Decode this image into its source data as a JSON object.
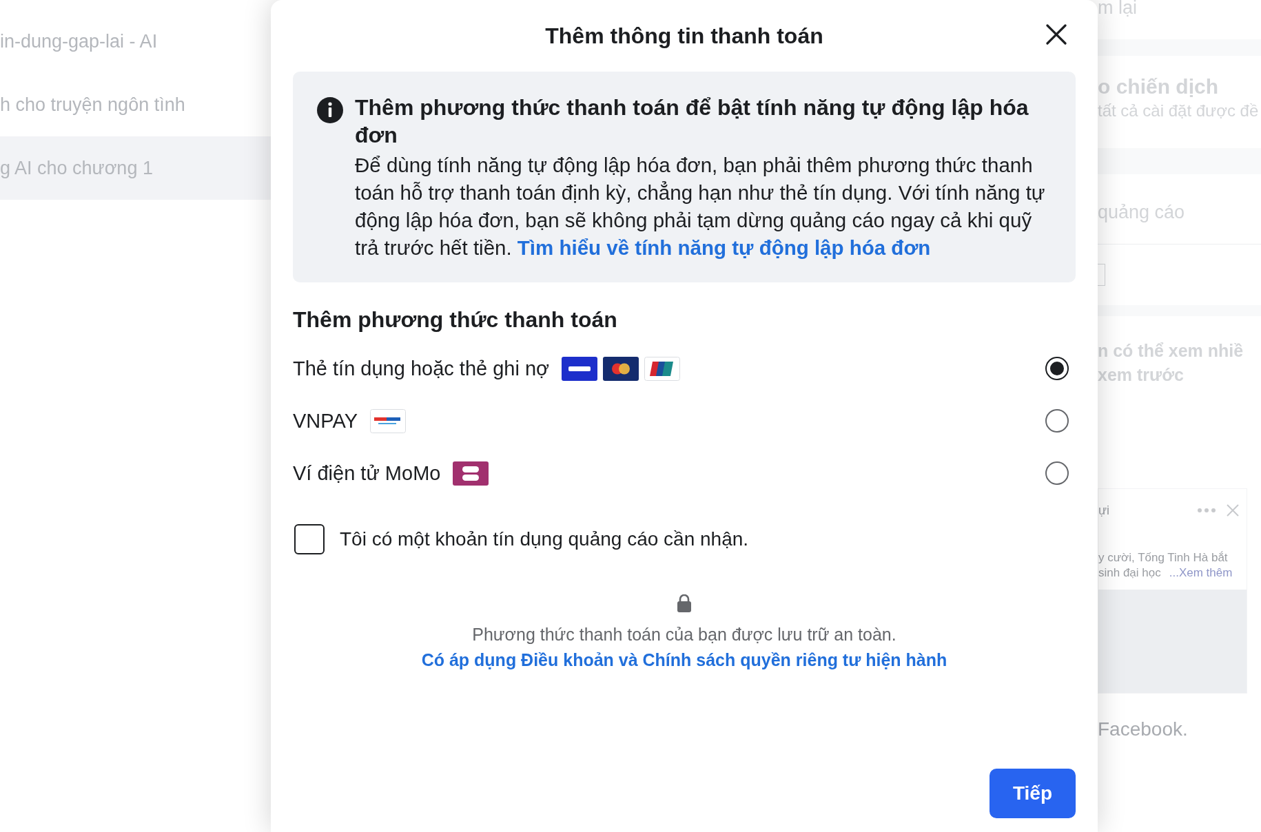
{
  "background_left": {
    "items": [
      {
        "label": "in-dung-gap-lai - AI",
        "selected": false
      },
      {
        "label": "h cho truyện ngôn tình",
        "selected": false
      },
      {
        "label": "g AI cho chương 1",
        "selected": true
      }
    ]
  },
  "background_right": {
    "top_text": "m lại",
    "section_title": "o chiến dịch",
    "section_subtitle": "tất cả cài đặt được đề",
    "field_label": "quảng cáo",
    "preview_title": "n có thể xem nhiề",
    "preview_title_2": "xem trước",
    "ad_card": {
      "author": "ựi",
      "text_1": "y cười, Tống Tinh Hà bắt",
      "text_2": "sinh đại học",
      "more_link": "...Xem thêm"
    },
    "footer_text": "Facebook."
  },
  "dialog": {
    "title": "Thêm thông tin thanh toán",
    "notice": {
      "title": "Thêm phương thức thanh toán để bật tính năng tự động lập hóa đơn",
      "body": "Để dùng tính năng tự động lập hóa đơn, bạn phải thêm phương thức thanh toán hỗ trợ thanh toán định kỳ, chẳng hạn như thẻ tín dụng. Với tính năng tự động lập hóa đơn, bạn sẽ không phải tạm dừng quảng cáo ngay cả khi quỹ trả trước hết tiền.",
      "link": "Tìm hiểu về tính năng tự động lập hóa đơn"
    },
    "section_title": "Thêm phương thức thanh toán",
    "methods": [
      {
        "label": "Thẻ tín dụng hoặc thẻ ghi nợ",
        "kind": "card",
        "selected": true
      },
      {
        "label": "VNPAY",
        "kind": "vnpay",
        "selected": false
      },
      {
        "label": "Ví điện tử MoMo",
        "kind": "momo",
        "selected": false
      }
    ],
    "credit_checkbox": {
      "label": "Tôi có một khoản tín dụng quảng cáo cần nhận.",
      "checked": false
    },
    "security_text": "Phương thức thanh toán của bạn được lưu trữ an toàn.",
    "terms_link": "Có áp dụng Điều khoản và Chính sách quyền riêng tư hiện hành",
    "next_button": "Tiếp"
  }
}
